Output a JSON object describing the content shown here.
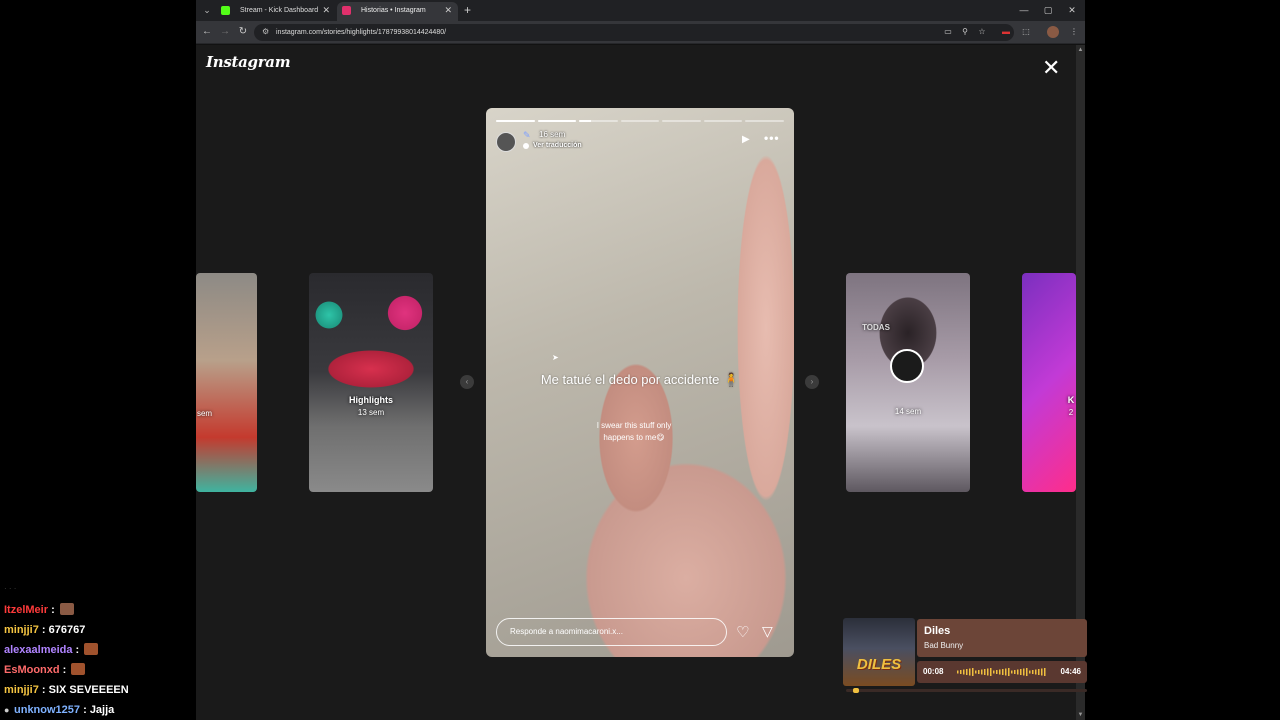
{
  "browser": {
    "tabs": [
      {
        "title": "Stream - Kick Dashboard",
        "favicon_color": "#53fc18",
        "active": false
      },
      {
        "title": "Historias • Instagram",
        "favicon_color": "#e1306c",
        "active": true
      }
    ],
    "url": "instagram.com/stories/highlights/17879938014424480/"
  },
  "instagram": {
    "logo": "Instagram",
    "side_stories": [
      {
        "id": "left-far",
        "label": "",
        "sublabel": "sem"
      },
      {
        "id": "highlights",
        "label": "Highlights",
        "sublabel": "13 sem"
      },
      {
        "id": "right-near",
        "label": "TODAS",
        "sublabel": "14 sem"
      },
      {
        "id": "right-far",
        "label": "K",
        "sublabel": "2"
      }
    ],
    "story": {
      "progress_segments": [
        1,
        1,
        0.3,
        0,
        0,
        0,
        0
      ],
      "time": "16 sem",
      "translate": "Ver traducción",
      "caption_main": "Me  tatué el dedo por accidente 🧍",
      "caption_sub": "I swear this stuff only happens to me😋",
      "reply_placeholder": "Responde a naomimacaroni.x..."
    }
  },
  "chat": {
    "faded": "· · ·",
    "messages": [
      {
        "user": "ItzelMeir",
        "color": "#ff3b3b",
        "text": "",
        "emote": "#8a5a44",
        "badge": false
      },
      {
        "user": "minjji7",
        "color": "#f5c542",
        "text": "676767",
        "emote": "",
        "badge": false
      },
      {
        "user": "alexaalmeida",
        "color": "#b084ff",
        "text": "",
        "emote": "#a0522d",
        "badge": false
      },
      {
        "user": "EsMoonxd",
        "color": "#ff6b6b",
        "text": "",
        "emote": "#a0522d",
        "badge": false
      },
      {
        "user": "minjji7",
        "color": "#f5c542",
        "text": "SIX SEVEEEEN",
        "emote": "",
        "badge": false
      },
      {
        "user": "unknow1257",
        "color": "#7fb2ff",
        "text": "Jajja",
        "emote": "",
        "badge": true
      }
    ]
  },
  "music": {
    "title": "Diles",
    "artist": "Bad Bunny",
    "current": "00:08",
    "duration": "04:46",
    "progress": 0.03,
    "art_text": "DILES"
  }
}
